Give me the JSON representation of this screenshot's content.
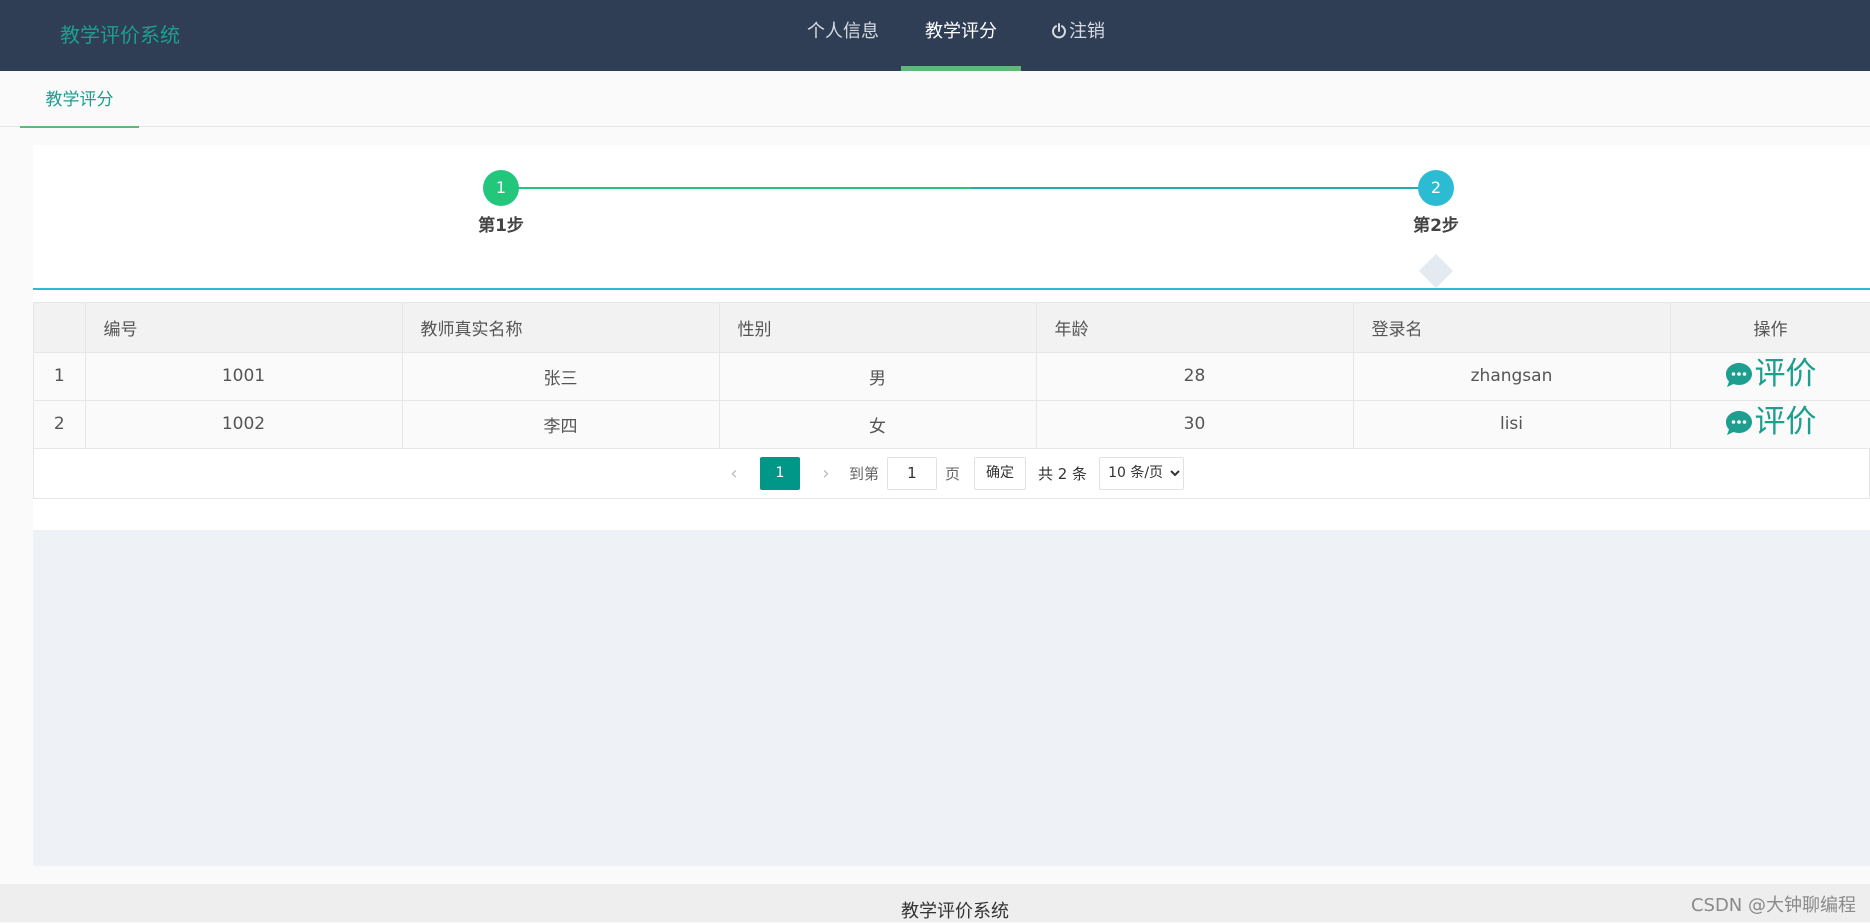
{
  "header": {
    "logo": "教学评价系统",
    "nav": [
      {
        "label": "个人信息"
      },
      {
        "label": "教学评分"
      },
      {
        "label": "注销"
      }
    ]
  },
  "tabs": [
    {
      "label": "教学评分"
    }
  ],
  "steps": [
    {
      "number": "1",
      "label": "第1步",
      "color": "#22c77b"
    },
    {
      "number": "2",
      "label": "第2步",
      "color": "#2bbcd4"
    }
  ],
  "table": {
    "headers": [
      "",
      "编号",
      "教师真实名称",
      "性别",
      "年龄",
      "登录名",
      "操作"
    ],
    "rows": [
      [
        "1",
        "1001",
        "张三",
        "男",
        "28",
        "zhangsan",
        "评价"
      ],
      [
        "2",
        "1002",
        "李四",
        "女",
        "30",
        "lisi",
        "评价"
      ]
    ]
  },
  "pagination": {
    "prev": "‹",
    "current": "1",
    "next": "›",
    "goto_label": "到第",
    "goto_value": "1",
    "page_unit": "页",
    "confirm": "确定",
    "total": "共 2 条",
    "page_size": "10 条/页"
  },
  "footer": {
    "text": "教学评价系统",
    "watermark": "CSDN @大钟聊编程"
  },
  "colors": {
    "header_bg": "#2f3e55",
    "accent": "#009688",
    "logo": "#1e9e8f",
    "nav_underline": "#5fb878",
    "step1": "#22c77b",
    "step2": "#2bbcd4"
  }
}
